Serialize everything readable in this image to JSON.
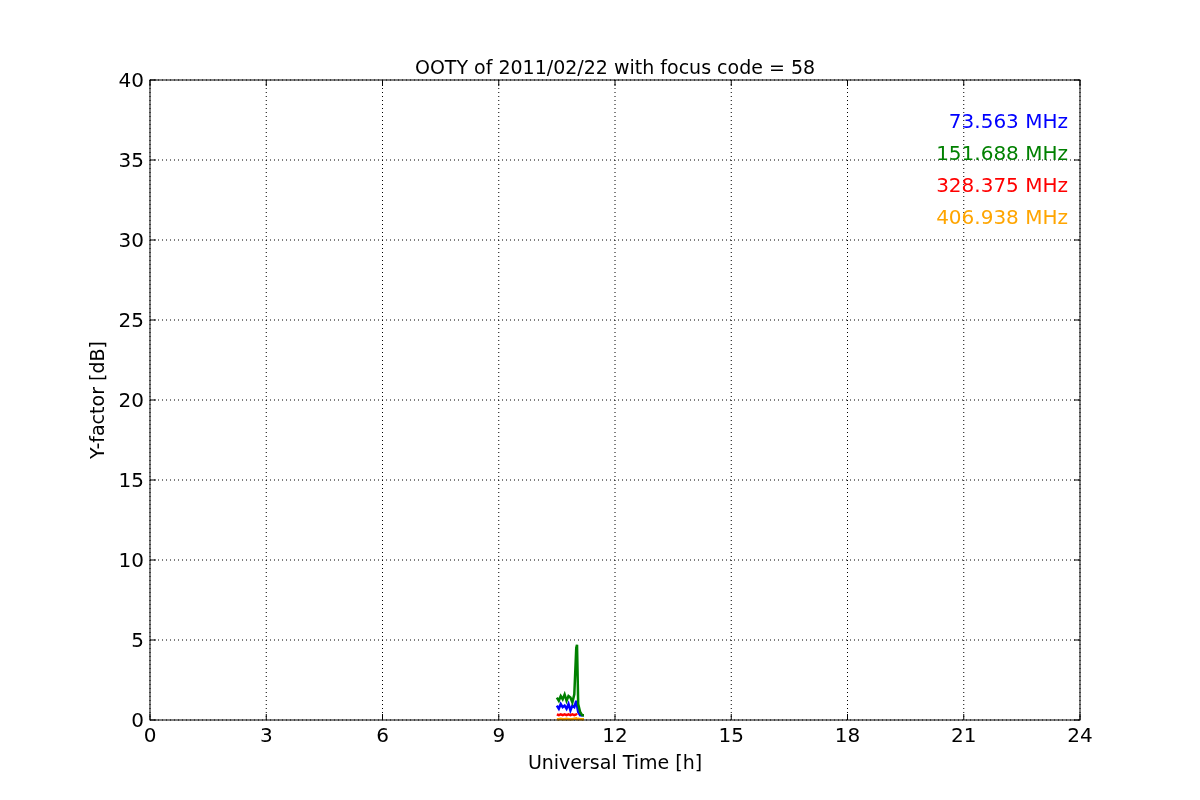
{
  "chart_data": {
    "type": "line",
    "title": "OOTY of 2011/02/22 with focus code = 58",
    "xlabel": "Universal Time [h]",
    "ylabel": "Y-factor [dB]",
    "x": [
      10.5,
      10.55,
      10.6,
      10.65,
      10.7,
      10.75,
      10.8,
      10.85,
      10.9,
      10.95,
      11.0,
      11.02,
      11.05,
      11.1,
      11.15,
      11.2
    ],
    "series": [
      {
        "name": "73.563 MHz",
        "color": "#0000ff",
        "values": [
          0.9,
          0.7,
          1.0,
          0.8,
          0.9,
          0.7,
          1.0,
          0.6,
          0.9,
          0.8,
          1.2,
          0.9,
          0.5,
          0.3,
          0.3,
          0.3
        ]
      },
      {
        "name": "151.688 MHz",
        "color": "#008000",
        "values": [
          1.4,
          1.2,
          1.5,
          1.3,
          1.6,
          1.2,
          1.5,
          1.4,
          1.1,
          1.6,
          4.5,
          4.7,
          1.0,
          0.5,
          0.3,
          0.3
        ]
      },
      {
        "name": "328.375 MHz",
        "color": "#ff0000",
        "values": [
          0.35,
          0.3,
          0.35,
          0.3,
          0.35,
          0.3,
          0.35,
          0.3,
          0.35,
          0.3,
          0.35,
          0.3,
          null,
          null,
          null,
          null
        ]
      },
      {
        "name": "406.938 MHz",
        "color": "#ffa500",
        "values": [
          0.05,
          0.05,
          0.08,
          0.05,
          0.05,
          0.08,
          0.05,
          0.05,
          0.05,
          0.08,
          0.1,
          0.05,
          0.08,
          0.05,
          0.05,
          0.05
        ]
      }
    ],
    "grid": true,
    "xlim": [
      0,
      24
    ],
    "ylim": [
      0,
      40
    ],
    "xticks": [
      0,
      3,
      6,
      9,
      12,
      15,
      18,
      21,
      24
    ],
    "yticks": [
      0,
      5,
      10,
      15,
      20,
      25,
      30,
      35,
      40
    ]
  }
}
